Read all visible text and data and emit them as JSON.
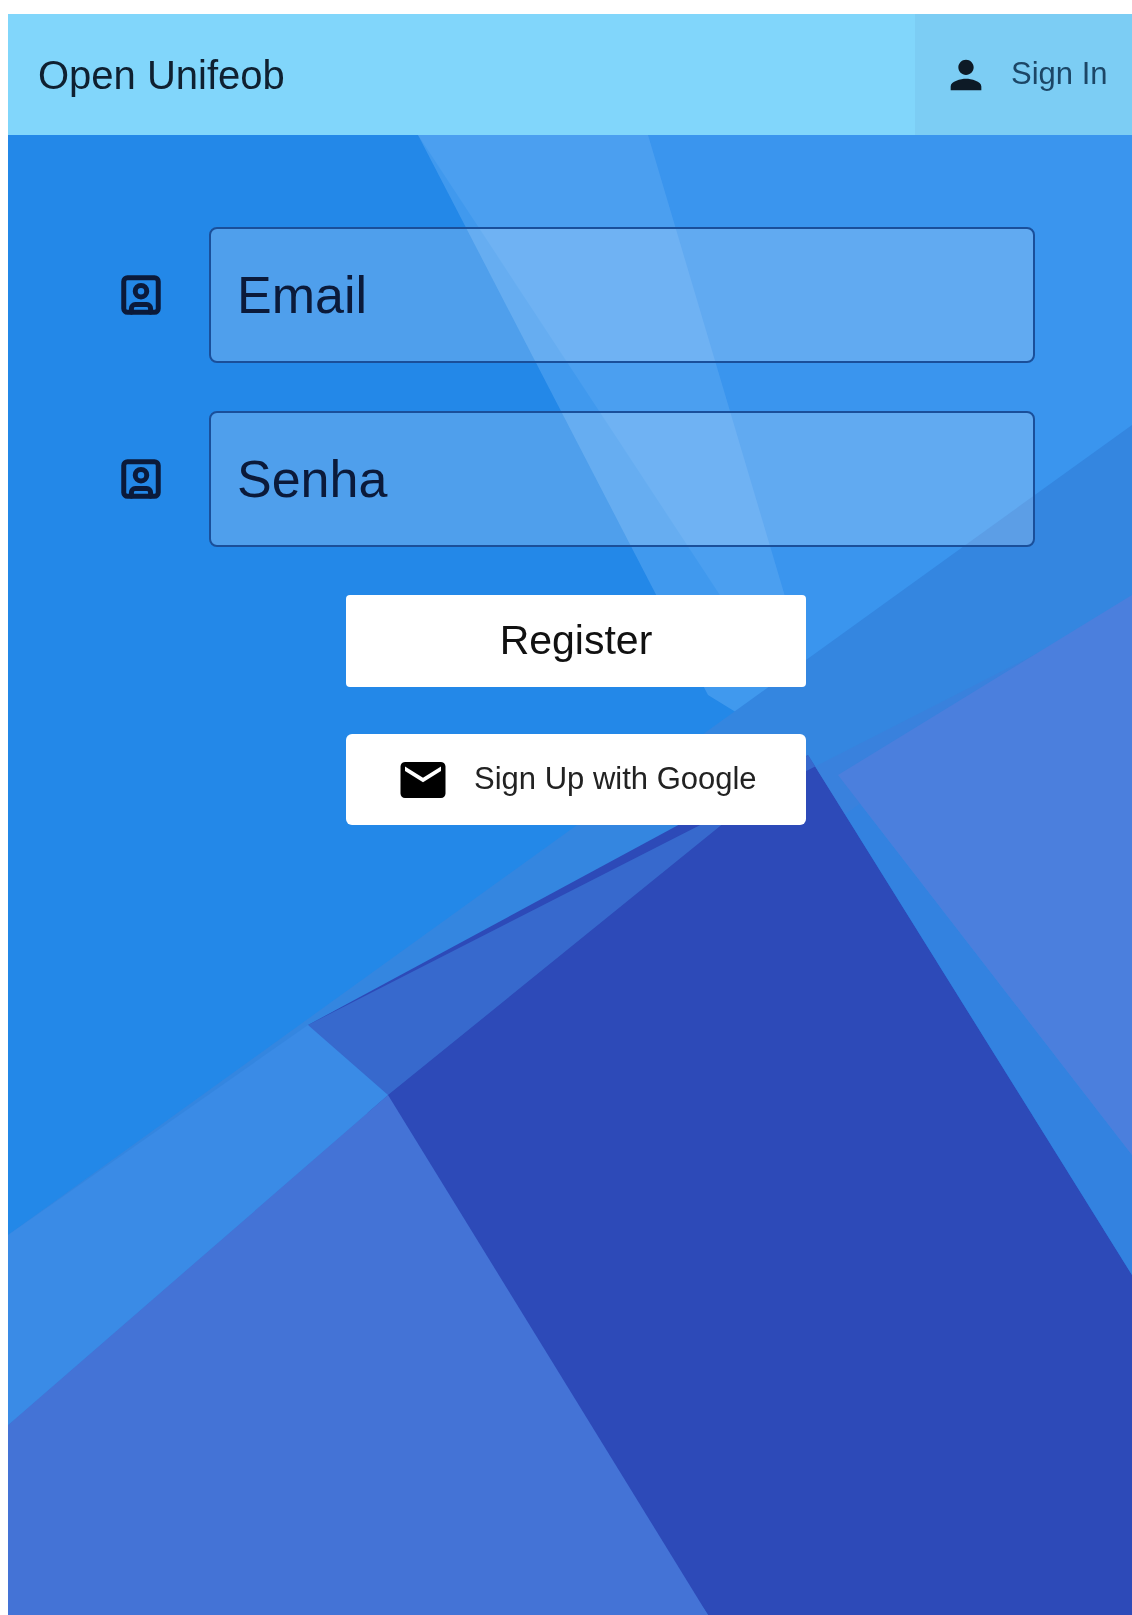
{
  "app_bar": {
    "title": "Open Unifeob",
    "sign_in": {
      "label": "Sign In"
    }
  },
  "fields": [
    {
      "placeholder": "Email"
    },
    {
      "placeholder": "Senha"
    }
  ],
  "buttons": [
    {
      "kind": "plain",
      "label": "Register"
    },
    {
      "kind": "google",
      "label": "Sign Up with Google"
    }
  ]
}
